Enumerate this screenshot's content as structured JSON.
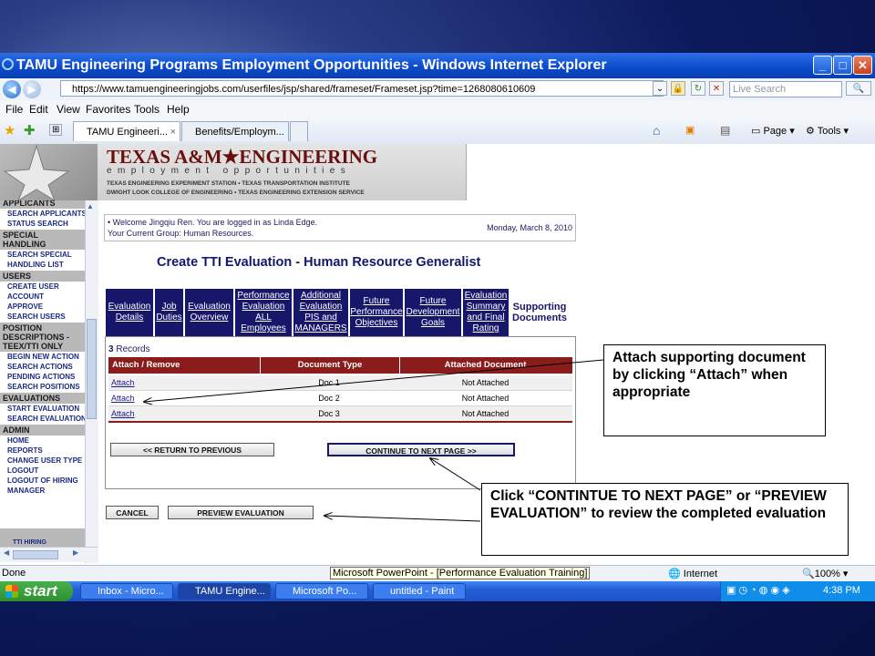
{
  "window": {
    "title": "TAMU Engineering Programs Employment Opportunities - Windows Internet Explorer"
  },
  "address": {
    "url": "https://www.tamuengineeringjobs.com/userfiles/jsp/shared/frameset/Frameset.jsp?time=1268080610609",
    "search_placeholder": "Live Search"
  },
  "menubar": [
    "File",
    "Edit",
    "View",
    "Favorites",
    "Tools",
    "Help"
  ],
  "tabs": [
    {
      "label": "TAMU Engineeri..."
    },
    {
      "label": "Benefits/Employm..."
    }
  ],
  "tab_close": "×",
  "toolbar": {
    "page_label": "Page",
    "tools_label": "Tools"
  },
  "banner": {
    "title": "TEXAS A&M★ENGINEERING",
    "subtitle": "employment opportunities",
    "line1": "TEXAS ENGINEERING EXPERIMENT STATION • TEXAS TRANSPORTATION INSTITUTE",
    "line2": "DWIGHT LOOK COLLEGE OF ENGINEERING • TEXAS ENGINEERING EXTENSION SERVICE"
  },
  "sidebar": [
    {
      "t": "h",
      "label": "APPLICANTS"
    },
    {
      "t": "i",
      "label": "SEARCH APPLICANTS"
    },
    {
      "t": "i",
      "label": "STATUS SEARCH"
    },
    {
      "t": "h",
      "label": "SPECIAL HANDLING"
    },
    {
      "t": "i",
      "label": "SEARCH SPECIAL"
    },
    {
      "t": "i",
      "label": "HANDLING LIST"
    },
    {
      "t": "h",
      "label": "USERS"
    },
    {
      "t": "i",
      "label": "CREATE USER"
    },
    {
      "t": "i",
      "label": "ACCOUNT"
    },
    {
      "t": "i",
      "label": "APPROVE"
    },
    {
      "t": "i",
      "label": "SEARCH USERS"
    },
    {
      "t": "h",
      "label": "POSITION DESCRIPTIONS - TEEX/TTI ONLY"
    },
    {
      "t": "i",
      "label": "BEGIN NEW ACTION"
    },
    {
      "t": "i",
      "label": "SEARCH ACTIONS"
    },
    {
      "t": "i",
      "label": "PENDING ACTIONS"
    },
    {
      "t": "i",
      "label": "SEARCH POSITIONS"
    },
    {
      "t": "h",
      "label": "EVALUATIONS"
    },
    {
      "t": "i",
      "label": "START EVALUATION"
    },
    {
      "t": "i",
      "label": "SEARCH EVALUATIONS"
    },
    {
      "t": "h",
      "label": "ADMIN"
    },
    {
      "t": "i",
      "label": "HOME"
    },
    {
      "t": "i",
      "label": "REPORTS"
    },
    {
      "t": "i",
      "label": "CHANGE USER TYPE"
    },
    {
      "t": "i",
      "label": "LOGOUT"
    },
    {
      "t": "i",
      "label": "LOGOUT OF HIRING"
    },
    {
      "t": "i",
      "label": "MANAGER"
    }
  ],
  "sidebar_footer": "TTI HIRING",
  "welcome": {
    "line1": "• Welcome Jingqiu Ren. You are logged in as Linda Edge.",
    "line2": "Your Current Group: Human Resources.",
    "date": "Monday, March 8, 2010"
  },
  "page_title": "Create TTI Evaluation - Human Resource Generalist",
  "eval_tabs": [
    "Evaluation Details",
    "Job Duties",
    "Evaluation Overview",
    "Performance Evaluation ALL Employees",
    "Additional Evaluation PIS and MANAGERS",
    "Future Performance Objectives",
    "Future Development Goals",
    "Evaluation Summary and Final Rating",
    "Supporting Documents"
  ],
  "records": {
    "count": "3",
    "label": "Records"
  },
  "table": {
    "headers": [
      "Attach / Remove",
      "Document Type",
      "Attached Document"
    ],
    "rows": [
      [
        "Attach",
        "Doc 1",
        "Not Attached"
      ],
      [
        "Attach",
        "Doc 2",
        "Not Attached"
      ],
      [
        "Attach",
        "Doc 3",
        "Not Attached"
      ]
    ]
  },
  "buttons": {
    "return": "<< RETURN TO PREVIOUS",
    "continue": "CONTINUE TO NEXT PAGE >>",
    "cancel": "CANCEL",
    "preview": "PREVIEW EVALUATION"
  },
  "callouts": {
    "attach": "Attach supporting document by clicking “Attach” when appropriate",
    "continue": "Click “CONTINTUE TO NEXT PAGE” or “PREVIEW EVALUATION” to review the completed evaluation"
  },
  "status": {
    "left": "Done",
    "zone": "Internet",
    "zoom": "100%",
    "tooltip": "Microsoft PowerPoint - [Performance Evaluation Training]"
  },
  "taskbar": {
    "start": "start",
    "items": [
      "Inbox - Micro...",
      "TAMU Engine...",
      "Microsoft Po...",
      "untitled - Paint"
    ],
    "clock": "4:38 PM"
  },
  "colors": {
    "navy": "#16166a",
    "maroon": "#8a1c1c",
    "xp_blue": "#245fd8",
    "xp_green": "#3a9f3d"
  }
}
